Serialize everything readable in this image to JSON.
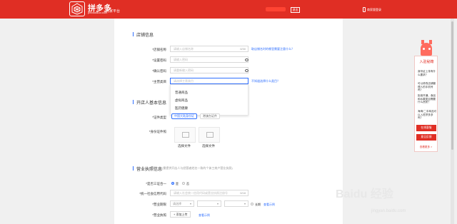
{
  "header": {
    "logo_title": "拼多多",
    "logo_domain": "pinduoduo.com",
    "platform": "商家平台",
    "logout": "退出",
    "mobile_label": "商家版登录"
  },
  "section_store": {
    "title": "店铺信息",
    "fields": [
      {
        "label": "*店铺名称",
        "placeholder": "请输入店铺名称",
        "counter": "0/30"
      },
      {
        "label": "*设置密码",
        "placeholder": "请输入密码"
      },
      {
        "label": "*确认密码",
        "placeholder": "请重新输入密码"
      },
      {
        "label": "*主营类目",
        "placeholder": "请选择主营类目"
      }
    ],
    "link_name_rule": "取店铺名时的哪里需要注意什么？",
    "link_category": "不知道选择什么类目？",
    "dropdown_options": [
      "普通商品",
      "虚拟商品",
      "医药健康"
    ]
  },
  "section_owner": {
    "title": "开店人基本信息",
    "label_id_type": "*证件类型",
    "label_id_photo": "*身份证件照",
    "pill_id_card": "中国大陆身份证",
    "pill_passport": "港澳台证件",
    "upload_caption": "选择文件"
  },
  "section_license": {
    "title": "营业执照信息",
    "hint": "(需提供开店人与经营者姓名一致的个体工商户营业执照)",
    "label_three_in_one": "*是否三证合一",
    "radio_yes": "是",
    "radio_no": "否",
    "label_credit_code": "*统一社会信用代码",
    "credit_code_placeholder": "请输入社会统一信用代码或营业执照注册号",
    "credit_counter": "0/18",
    "label_valid_period": "*营业期限",
    "select_year": "请选择",
    "select_long_term": "长期",
    "sample_link": "查看示例",
    "label_license_img": "*营业执照",
    "upload_btn": "+ 添加上传"
  },
  "float_panel": {
    "title": "入驻秘籍",
    "questions": [
      "身份证上传有什么要求？",
      "可以修改店铺管理人的手机号吗？",
      "拒绝开通，食品和水果类目需要什么资质？",
      "海淘/二手商品可以入驻拼多多吗？"
    ],
    "btn_online": "在线客服",
    "btn_feedback": "意见反馈",
    "more_link": "查看更多 >"
  },
  "watermark": {
    "main": "Baidu 经验",
    "sub": "jingyan.baidu.com"
  },
  "colors": {
    "brand_red": "#e02e24",
    "link_blue": "#2f6fff"
  }
}
